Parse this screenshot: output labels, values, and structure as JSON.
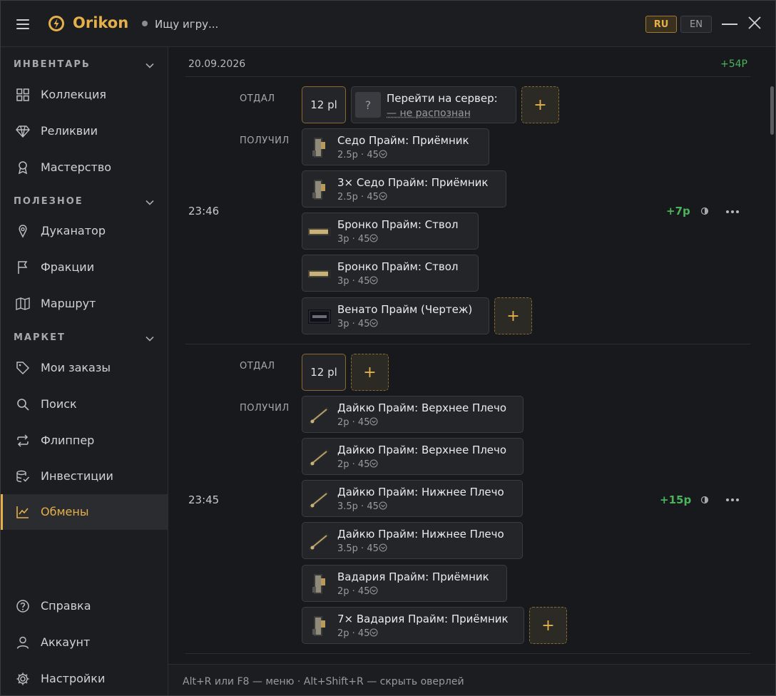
{
  "app": {
    "name": "Orikon",
    "game_status": "Ищу игру...",
    "lang_active": "RU",
    "lang_other": "EN"
  },
  "sidebar": {
    "sections": [
      {
        "title": "ИНВЕНТАРЬ",
        "items": [
          "Коллекция",
          "Реликвии",
          "Мастерство"
        ]
      },
      {
        "title": "ПОЛЕЗНОЕ",
        "items": [
          "Дуканатор",
          "Фракции",
          "Маршрут"
        ]
      },
      {
        "title": "МАРКЕТ",
        "items": [
          "Мои заказы",
          "Поиск",
          "Флиппер",
          "Инвестиции",
          "Обмены"
        ]
      }
    ],
    "active": "Обмены",
    "bottom": [
      "Справка",
      "Аккаунт",
      "Настройки"
    ]
  },
  "main": {
    "date": "20.09.2026",
    "date_total": "+54Р",
    "labels": {
      "gave": "ОТДАЛ",
      "got": "ПОЛУЧИЛ"
    },
    "add_label": "+",
    "trades": [
      {
        "time": "23:46",
        "profit": "+7р",
        "gave_plat": "12 pl",
        "gave_unknown": {
          "name": "Перейти на сервер:",
          "sub": "— не распознан",
          "thumb": "?"
        },
        "got": [
          {
            "name": "Седо Прайм: Приёмник",
            "sub": "2.5р · 45"
          },
          {
            "name": "3× Седо Прайм: Приёмник",
            "sub": "2.5р · 45"
          },
          {
            "name": "Бронко Прайм: Ствол",
            "sub": "3р · 45"
          },
          {
            "name": "Бронко Прайм: Ствол",
            "sub": "3р · 45"
          },
          {
            "name": "Венато Прайм (Чертеж)",
            "sub": "3р · 45"
          }
        ]
      },
      {
        "time": "23:45",
        "profit": "+15р",
        "gave_plat": "12 pl",
        "got": [
          {
            "name": "Дайкю Прайм: Верхнее Плечо",
            "sub": "2р · 45"
          },
          {
            "name": "Дайкю Прайм: Верхнее Плечо",
            "sub": "2р · 45"
          },
          {
            "name": "Дайкю Прайм: Нижнее Плечо",
            "sub": "3.5р · 45"
          },
          {
            "name": "Дайкю Прайм: Нижнее Плечо",
            "sub": "3.5р · 45"
          },
          {
            "name": "Вадария Прайм: Приёмник",
            "sub": "2р · 45"
          },
          {
            "name": "7× Вадария Прайм: Приёмник",
            "sub": "2р · 45"
          }
        ]
      }
    ]
  },
  "footer": {
    "hint": "Alt+R или F8 — меню · Alt+Shift+R — скрыть оверлей"
  },
  "colors": {
    "accent": "#e5b04a",
    "profit": "#4bb35a",
    "bg": "#17191d"
  }
}
